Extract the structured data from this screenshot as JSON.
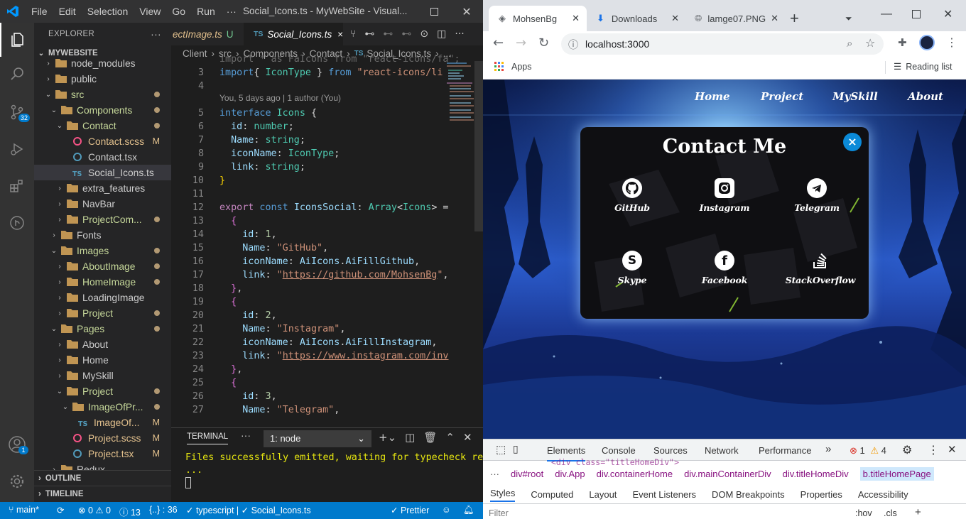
{
  "vscode": {
    "menu": [
      "File",
      "Edit",
      "Selection",
      "View",
      "Go",
      "Run",
      "···"
    ],
    "window_title": "Social_Icons.ts - MyWebSite - Visual...",
    "activity_badges": {
      "scm": "32",
      "accounts": "1"
    },
    "explorer": {
      "header": "EXPLORER",
      "root": "MYWEBSITE",
      "items": [
        {
          "label": "node_modules",
          "depth": 1,
          "type": "folder",
          "open": false
        },
        {
          "label": "public",
          "depth": 1,
          "type": "folder",
          "open": false
        },
        {
          "label": "src",
          "depth": 1,
          "type": "folder",
          "open": true,
          "status": "dot"
        },
        {
          "label": "Components",
          "depth": 2,
          "type": "folder",
          "open": true,
          "status": "dot"
        },
        {
          "label": "Contact",
          "depth": 3,
          "type": "folder",
          "open": true,
          "status": "dot"
        },
        {
          "label": "Contact.scss",
          "depth": 4,
          "type": "scss",
          "status": "M"
        },
        {
          "label": "Contact.tsx",
          "depth": 4,
          "type": "tsx"
        },
        {
          "label": "Social_Icons.ts",
          "depth": 4,
          "type": "ts",
          "selected": true
        },
        {
          "label": "extra_features",
          "depth": 3,
          "type": "folder",
          "open": false
        },
        {
          "label": "NavBar",
          "depth": 3,
          "type": "folder",
          "open": false
        },
        {
          "label": "ProjectCom...",
          "depth": 3,
          "type": "folder",
          "open": false,
          "status": "dot"
        },
        {
          "label": "Fonts",
          "depth": 2,
          "type": "folder",
          "open": false
        },
        {
          "label": "Images",
          "depth": 2,
          "type": "folder",
          "open": true,
          "status": "dot"
        },
        {
          "label": "AboutImage",
          "depth": 3,
          "type": "folder",
          "open": false,
          "status": "dot"
        },
        {
          "label": "HomeImage",
          "depth": 3,
          "type": "folder",
          "open": false,
          "status": "dot"
        },
        {
          "label": "LoadingImage",
          "depth": 3,
          "type": "folder",
          "open": false
        },
        {
          "label": "Project",
          "depth": 3,
          "type": "folder",
          "open": false,
          "status": "dot"
        },
        {
          "label": "Pages",
          "depth": 2,
          "type": "folder",
          "open": true,
          "status": "dot"
        },
        {
          "label": "About",
          "depth": 3,
          "type": "folder",
          "open": false
        },
        {
          "label": "Home",
          "depth": 3,
          "type": "folder",
          "open": false
        },
        {
          "label": "MySkill",
          "depth": 3,
          "type": "folder",
          "open": false
        },
        {
          "label": "Project",
          "depth": 3,
          "type": "folder",
          "open": true,
          "status": "dot"
        },
        {
          "label": "ImageOfPr...",
          "depth": 4,
          "type": "folder",
          "open": true,
          "status": "dot"
        },
        {
          "label": "ImageOf...",
          "depth": 5,
          "type": "ts",
          "status": "M"
        },
        {
          "label": "Project.scss",
          "depth": 4,
          "type": "scss",
          "status": "M"
        },
        {
          "label": "Project.tsx",
          "depth": 4,
          "type": "tsx",
          "status": "M"
        },
        {
          "label": "Redux",
          "depth": 2,
          "type": "folder",
          "open": false
        }
      ],
      "outline": "OUTLINE",
      "timeline": "TIMELINE"
    },
    "tabs": [
      {
        "label": "ectImage.ts",
        "badge": "U",
        "active": false
      },
      {
        "label": "Social_Icons.ts",
        "badge": "×",
        "active": true,
        "prefix": "TS"
      }
    ],
    "breadcrumb": [
      "Client",
      "src",
      "Components",
      "Contact",
      "Social_Icons.ts",
      "..."
    ],
    "codelens": "You, 5 days ago | 1 author (You)",
    "code": [
      {
        "n": "",
        "html": "import * as FaIcons from \"react-icons/fa\";",
        "partial": true
      },
      {
        "n": "3",
        "segs": [
          [
            "k",
            "import"
          ],
          [
            "",
            "{ "
          ],
          [
            "t",
            "IconType"
          ],
          [
            "",
            " } "
          ],
          [
            "k",
            "from"
          ],
          [
            "s",
            " \"react-icons/li"
          ]
        ]
      },
      {
        "n": "4",
        "segs": []
      },
      {
        "n": "5",
        "segs": [
          [
            "k",
            "interface"
          ],
          [
            "t",
            " Icons"
          ],
          [
            "",
            " {"
          ]
        ]
      },
      {
        "n": "6",
        "segs": [
          [
            "",
            "  "
          ],
          [
            "p",
            "id"
          ],
          [
            "",
            ": "
          ],
          [
            "t",
            "number"
          ],
          [
            "",
            ";"
          ]
        ]
      },
      {
        "n": "7",
        "segs": [
          [
            "",
            "  "
          ],
          [
            "p",
            "Name"
          ],
          [
            "",
            ": "
          ],
          [
            "t",
            "string"
          ],
          [
            "",
            ";"
          ]
        ]
      },
      {
        "n": "8",
        "segs": [
          [
            "",
            "  "
          ],
          [
            "p",
            "iconName"
          ],
          [
            "",
            ": "
          ],
          [
            "t",
            "IconType"
          ],
          [
            "",
            ";"
          ]
        ]
      },
      {
        "n": "9",
        "segs": [
          [
            "",
            "  "
          ],
          [
            "p",
            "link"
          ],
          [
            "",
            ": "
          ],
          [
            "t",
            "string"
          ],
          [
            "",
            ";"
          ]
        ]
      },
      {
        "n": "10",
        "segs": [
          [
            "y",
            "}"
          ]
        ]
      },
      {
        "n": "11",
        "segs": []
      },
      {
        "n": "12",
        "segs": [
          [
            "m",
            "export"
          ],
          [
            "k",
            " const "
          ],
          [
            "p",
            "IconsSocial"
          ],
          [
            "",
            ": "
          ],
          [
            "t",
            "Array"
          ],
          [
            "",
            "<"
          ],
          [
            "t",
            "Icons"
          ],
          [
            "",
            "> ="
          ]
        ]
      },
      {
        "n": "13",
        "segs": [
          [
            "",
            "  "
          ],
          [
            "g",
            "{"
          ]
        ]
      },
      {
        "n": "14",
        "segs": [
          [
            "",
            "    "
          ],
          [
            "p",
            "id"
          ],
          [
            "",
            ": "
          ],
          [
            "n",
            "1"
          ],
          [
            "",
            ","
          ]
        ]
      },
      {
        "n": "15",
        "segs": [
          [
            "",
            "    "
          ],
          [
            "p",
            "Name"
          ],
          [
            "",
            ": "
          ],
          [
            "s",
            "\"GitHub\""
          ],
          [
            "",
            ","
          ]
        ]
      },
      {
        "n": "16",
        "segs": [
          [
            "",
            "    "
          ],
          [
            "p",
            "iconName"
          ],
          [
            "",
            ": "
          ],
          [
            "p",
            "AiIcons"
          ],
          [
            "",
            "."
          ],
          [
            "p",
            "AiFillGithub"
          ],
          [
            "",
            ","
          ]
        ]
      },
      {
        "n": "17",
        "segs": [
          [
            "",
            "    "
          ],
          [
            "p",
            "link"
          ],
          [
            "",
            ": "
          ],
          [
            "s",
            "\""
          ],
          [
            "su",
            "https://github.com/MohsenBg"
          ],
          [
            "s",
            "\""
          ],
          [
            "",
            ","
          ]
        ]
      },
      {
        "n": "18",
        "segs": [
          [
            "",
            "  "
          ],
          [
            "g",
            "}"
          ],
          [
            "",
            ","
          ]
        ]
      },
      {
        "n": "19",
        "segs": [
          [
            "",
            "  "
          ],
          [
            "g",
            "{"
          ]
        ]
      },
      {
        "n": "20",
        "segs": [
          [
            "",
            "    "
          ],
          [
            "p",
            "id"
          ],
          [
            "",
            ": "
          ],
          [
            "n",
            "2"
          ],
          [
            "",
            ","
          ]
        ]
      },
      {
        "n": "21",
        "segs": [
          [
            "",
            "    "
          ],
          [
            "p",
            "Name"
          ],
          [
            "",
            ": "
          ],
          [
            "s",
            "\"Instagram\""
          ],
          [
            "",
            ","
          ]
        ]
      },
      {
        "n": "22",
        "segs": [
          [
            "",
            "    "
          ],
          [
            "p",
            "iconName"
          ],
          [
            "",
            ": "
          ],
          [
            "p",
            "AiIcons"
          ],
          [
            "",
            "."
          ],
          [
            "p",
            "AiFillInstagram"
          ],
          [
            "",
            ","
          ]
        ]
      },
      {
        "n": "23",
        "segs": [
          [
            "",
            "    "
          ],
          [
            "p",
            "link"
          ],
          [
            "",
            ": "
          ],
          [
            "s",
            "\""
          ],
          [
            "su",
            "https://www.instagram.com/inv"
          ]
        ]
      },
      {
        "n": "24",
        "segs": [
          [
            "",
            "  "
          ],
          [
            "g",
            "}"
          ],
          [
            "",
            ","
          ]
        ]
      },
      {
        "n": "25",
        "segs": [
          [
            "",
            "  "
          ],
          [
            "g",
            "{"
          ]
        ]
      },
      {
        "n": "26",
        "segs": [
          [
            "",
            "    "
          ],
          [
            "p",
            "id"
          ],
          [
            "",
            ": "
          ],
          [
            "n",
            "3"
          ],
          [
            "",
            ","
          ]
        ]
      },
      {
        "n": "27",
        "segs": [
          [
            "",
            "    "
          ],
          [
            "p",
            "Name"
          ],
          [
            "",
            ": "
          ],
          [
            "s",
            "\"Telegram\""
          ],
          [
            "",
            ","
          ]
        ]
      }
    ],
    "terminal": {
      "tab": "TERMINAL",
      "dots": "···",
      "select": "1: node",
      "line1": "Files successfully emitted, waiting for typecheck results",
      "line2": "..."
    },
    "status": {
      "branch": "main*",
      "problems": "⊗ 0 ⚠ 0",
      "info": "13",
      "braces": "{..} : 36",
      "lang": "✓ typescript | ✓ Social_Icons.ts",
      "prettier": "✓ Prettier"
    }
  },
  "chrome": {
    "tabs": [
      {
        "label": "MohsenBg",
        "active": true
      },
      {
        "label": "Downloads",
        "active": false
      },
      {
        "label": "lamge07.PNG",
        "active": false
      }
    ],
    "url": "localhost:3000",
    "bookmarks": {
      "apps": "Apps",
      "reading_list": "Reading list"
    },
    "site": {
      "nav": [
        "Home",
        "Project",
        "MySkill",
        "About"
      ],
      "modal_title": "Contact Me",
      "close": "×",
      "socials": [
        "GitHub",
        "Instagram",
        "Telegram",
        "Skype",
        "Facebook",
        "StackOverflow"
      ]
    },
    "devtools": {
      "tabs": [
        "Elements",
        "Console",
        "Sources",
        "Network",
        "Performance"
      ],
      "more": "»",
      "errors": "1",
      "warnings": "4",
      "dom_crumbs": [
        "div#root",
        "div.App",
        "div.containerHome",
        "div.mainContainerDiv",
        "div.titleHomeDiv",
        "b.titleHomePage"
      ],
      "dom_snippet": "<div class=\"titleHomeDiv\">",
      "style_tabs": [
        "Styles",
        "Computed",
        "Layout",
        "Event Listeners",
        "DOM Breakpoints",
        "Properties",
        "Accessibility"
      ],
      "filter": "Filter",
      "hov": ":hov",
      "cls": ".cls",
      "plus": "+"
    }
  }
}
